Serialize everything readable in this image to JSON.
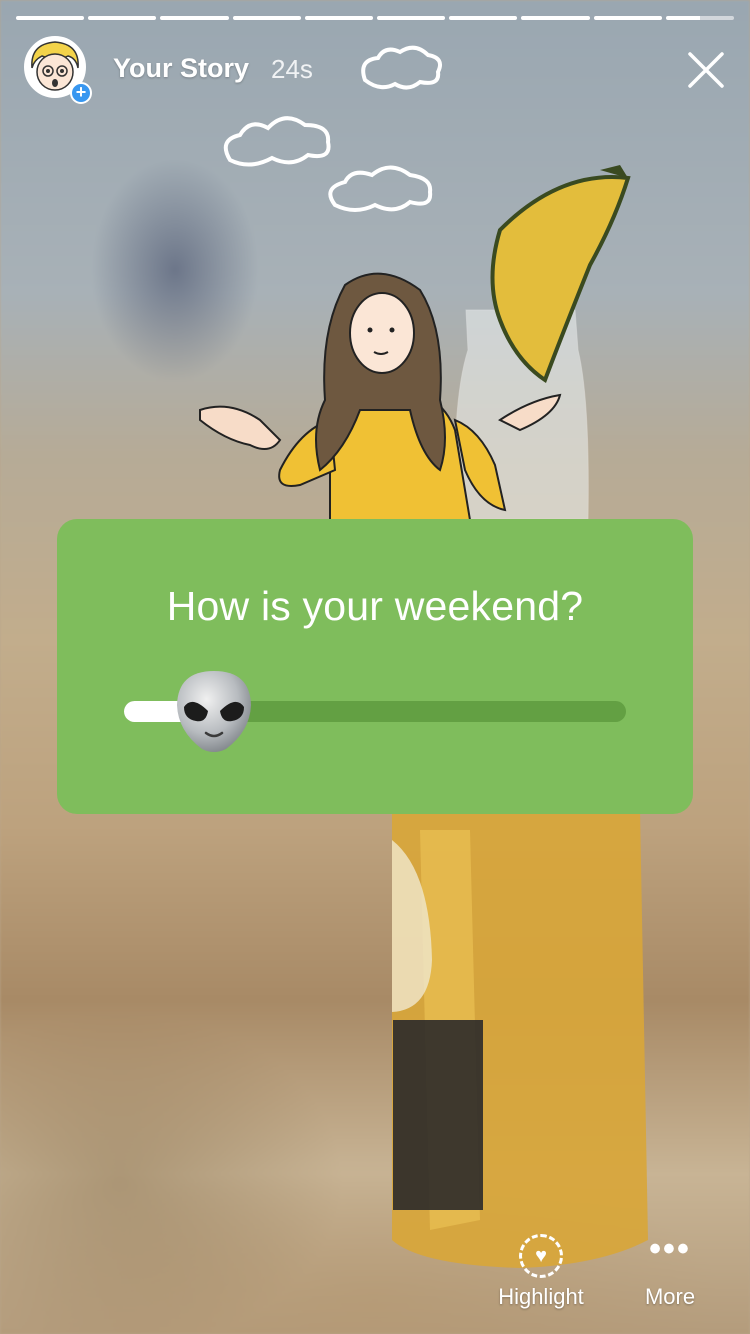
{
  "story": {
    "progress_total": 10,
    "progress_complete": 9.5,
    "name": "Your Story",
    "elapsed": "24s"
  },
  "header": {
    "avatar_icon": "cartoon-avatar-icon",
    "add_icon": "plus-badge-icon",
    "close_icon": "close-icon"
  },
  "poll": {
    "question": "How is your weekend?",
    "slider_value": 0.18,
    "emoji": "alien-face",
    "card_color": "#7fbd5c",
    "track_color": "#63a043"
  },
  "actions": {
    "highlight_label": "Highlight",
    "highlight_icon": "heart-circle-icon",
    "more_label": "More",
    "more_icon": "more-dots-icon"
  },
  "stickers": [
    "cloud-doodles",
    "shrugging-girl-illustration",
    "bottle-with-lime"
  ]
}
